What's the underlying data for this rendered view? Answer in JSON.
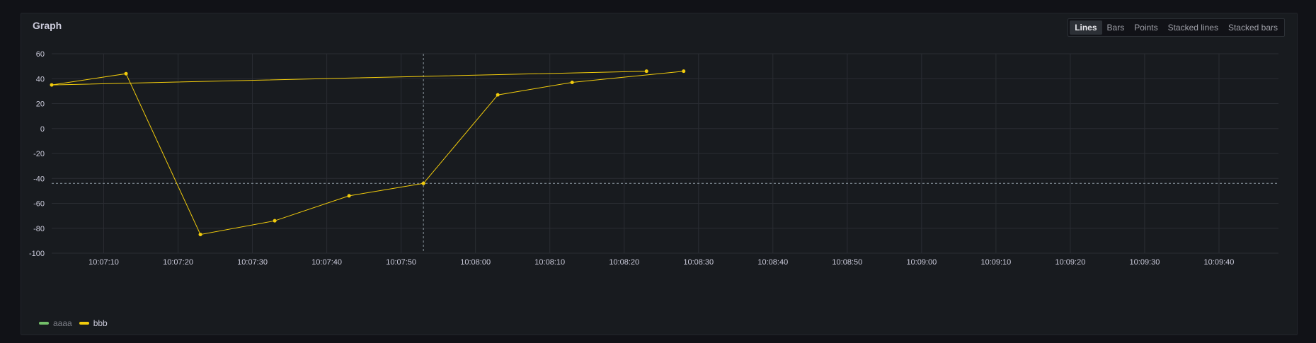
{
  "panel": {
    "title": "Graph",
    "view_options": [
      "Lines",
      "Bars",
      "Points",
      "Stacked lines",
      "Stacked bars"
    ],
    "active_view": "Lines"
  },
  "colors": {
    "series_bbb": "#f2cc0c",
    "series_aaaa": "#73bf69",
    "grid": "#2a2d33",
    "crosshair": "#8e9aa3"
  },
  "legend": [
    {
      "name": "aaaa",
      "color": "#73bf69",
      "muted": true
    },
    {
      "name": "bbb",
      "color": "#f2cc0c",
      "muted": false
    }
  ],
  "chart_data": {
    "type": "line",
    "title": "",
    "xlabel": "",
    "ylabel": "",
    "ylim": [
      -100,
      60
    ],
    "y_ticks": [
      60,
      40,
      20,
      0,
      -20,
      -40,
      -60,
      -80,
      -100
    ],
    "x_range": [
      "10:07:03",
      "10:09:48"
    ],
    "x_ticks": [
      "10:07:10",
      "10:07:20",
      "10:07:30",
      "10:07:40",
      "10:07:50",
      "10:08:00",
      "10:08:10",
      "10:08:20",
      "10:08:30",
      "10:08:40",
      "10:08:50",
      "10:09:00",
      "10:09:10",
      "10:09:20",
      "10:09:30",
      "10:09:40"
    ],
    "series": [
      {
        "name": "aaaa",
        "points": []
      },
      {
        "name": "bbb",
        "points": [
          {
            "x": "10:08:23",
            "y": 46
          },
          {
            "x": "10:07:03",
            "y": 35
          },
          {
            "x": "10:07:13",
            "y": 44
          },
          {
            "x": "10:07:23",
            "y": -85
          },
          {
            "x": "10:07:33",
            "y": -74
          },
          {
            "x": "10:07:43",
            "y": -54
          },
          {
            "x": "10:07:53",
            "y": -44
          },
          {
            "x": "10:08:03",
            "y": 27
          },
          {
            "x": "10:08:13",
            "y": 37
          },
          {
            "x": "10:08:28",
            "y": 46
          }
        ]
      }
    ],
    "crosshair": {
      "x": "10:07:53",
      "y": -44
    },
    "grid": true,
    "legend_position": "bottom-left"
  }
}
